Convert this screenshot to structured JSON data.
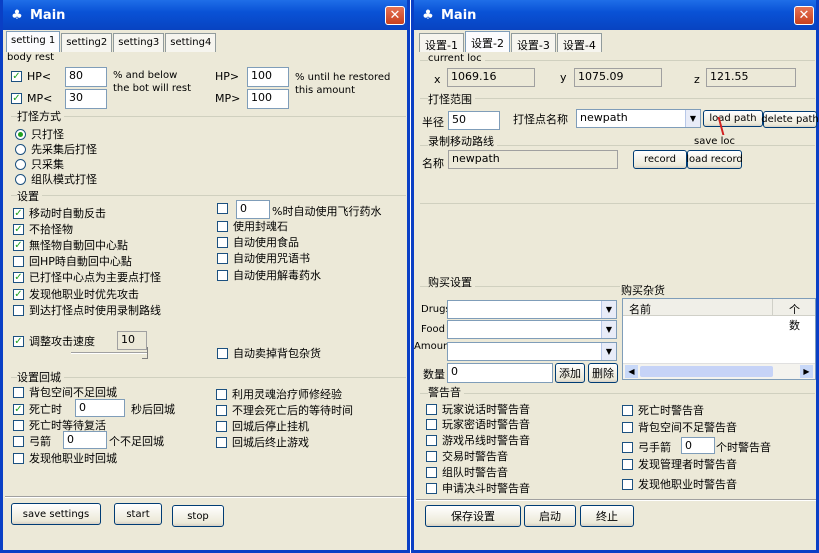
{
  "left": {
    "title": "Main",
    "tabs": [
      "setting 1",
      "setting2",
      "setting3",
      "setting4"
    ],
    "body_rest": "body rest",
    "hp": {
      "label": "HP<",
      "value": "80",
      "note1": "% and below",
      "note2": "the bot will rest",
      "right_label": "HP>",
      "right_value": "100",
      "right_note1": "% until he restored",
      "right_note2": "this amount"
    },
    "mp": {
      "label": "MP<",
      "value": "30",
      "right_label": "MP>",
      "right_value": "100"
    },
    "fight_mode": {
      "title": "打怪方式",
      "options": [
        "只打怪",
        "先采集后打怪",
        "只采集",
        "组队模式打怪"
      ],
      "selected": 0
    },
    "settings": {
      "title": "设置",
      "left_items": [
        {
          "label": "移动时自動反击",
          "checked": true
        },
        {
          "label": "不拾怪物",
          "checked": true
        },
        {
          "label": "無怪物自動回中心點",
          "checked": true
        },
        {
          "label": "回HP時自動回中心點",
          "checked": false
        },
        {
          "label": "已打怪中心点为主要点打怪",
          "checked": true
        },
        {
          "label": "发现他职业时优先攻击",
          "checked": true
        },
        {
          "label": "到达打怪点时使用录制路线",
          "checked": false
        }
      ],
      "fly": {
        "value": "0",
        "label": "%时自动使用飞行药水"
      },
      "right_items": [
        "使用封魂石",
        "自动使用食品",
        "自动使用咒语书",
        "自动使用解毒药水"
      ],
      "attack_speed": {
        "label": "调整攻击速度",
        "value": "10",
        "checked": true
      },
      "auto_sell": "自动卖掉背包杂货"
    },
    "return": {
      "title": "设置回城",
      "bag_full": "背包空间不足回城",
      "death": {
        "label": "死亡时",
        "value": "0",
        "suffix": "秒后回城",
        "checked": true
      },
      "wait_revive": "死亡时等待复活",
      "arrow": {
        "label": "弓箭",
        "value": "0",
        "suffix": "个不足回城"
      },
      "other_class": "发现他职业时回城",
      "right_items": [
        "利用灵魂治疗师修经验",
        "不理会死亡后的等待时间",
        "回城后停止挂机",
        "回城后终止游戏"
      ]
    },
    "buttons": {
      "save": "save settings",
      "start": "start",
      "stop": "stop"
    }
  },
  "right": {
    "title": "Main",
    "tabs": [
      "设置-1",
      "设置-2",
      "设置-3",
      "设置-4"
    ],
    "current_loc": {
      "title": "current loc",
      "x_label": "x",
      "x": "1069.16",
      "y_label": "y",
      "y": "1075.09",
      "z_label": "z",
      "z": "121.55"
    },
    "fight_range": {
      "title": "打怪范围",
      "radius_label": "半径",
      "radius": "50",
      "point_label": "打怪点名称",
      "point": "newpath",
      "load_path": "load path",
      "delete_path": "delete path",
      "save_loc": "save loc"
    },
    "record": {
      "title": "录制移动路线",
      "name_label": "名称",
      "name": "newpath",
      "record": "record",
      "load_record": "load record"
    },
    "buy": {
      "title": "购买设置",
      "drugs": "Drugs",
      "food": "Food",
      "amount": "Amount",
      "qty_label": "数量",
      "qty": "0",
      "add": "添加",
      "delete": "删除"
    },
    "buy_list": {
      "title": "购买杂货",
      "col_name": "名前",
      "col_count": "个数"
    },
    "alarm": {
      "title": "警告音",
      "left_items": [
        "玩家说话时警告音",
        "玩家密语时警告音",
        "游戏吊线时警告音",
        "交易时警告音",
        "组队时警告音",
        "申请决斗时警告音"
      ],
      "right_items": [
        "死亡时警告音",
        "背包空间不足警告音"
      ],
      "archer": {
        "label": "弓手箭",
        "value": "0",
        "suffix": "个时警告音"
      },
      "right_items2": [
        "发现管理者时警告音",
        "发现他职业时警告音"
      ]
    },
    "buttons": {
      "save": "保存设置",
      "start": "启动",
      "stop": "终止"
    }
  },
  "colors": {
    "titlebar": "#0952d6",
    "window_bg": "#ece9d8",
    "close": "#c8401e",
    "check": "#21a121"
  }
}
